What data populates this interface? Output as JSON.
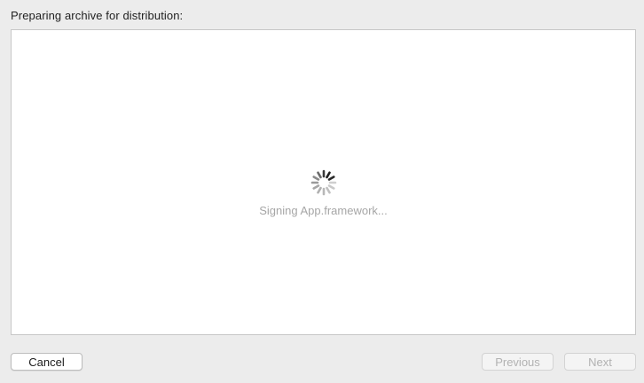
{
  "header": {
    "title": "Preparing archive for distribution:"
  },
  "main": {
    "status_text": "Signing App.framework..."
  },
  "footer": {
    "cancel_label": "Cancel",
    "previous_label": "Previous",
    "next_label": "Next"
  },
  "spinner": {
    "icon": "progress-spinner-icon"
  }
}
